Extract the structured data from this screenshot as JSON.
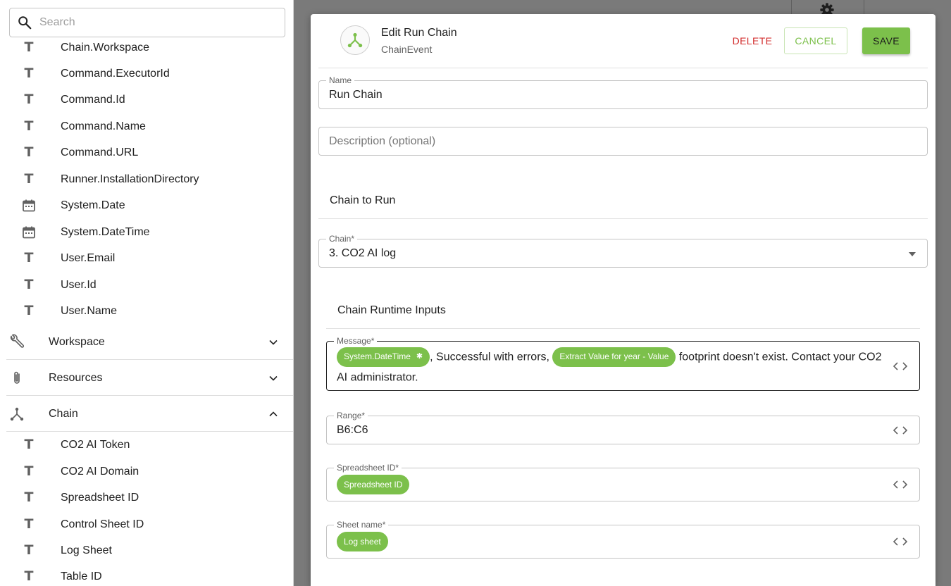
{
  "search": {
    "placeholder": "Search"
  },
  "variables_top": [
    {
      "label": "Chain.Workspace",
      "icon": "text-type-icon"
    },
    {
      "label": "Command.ExecutorId",
      "icon": "text-type-icon"
    },
    {
      "label": "Command.Id",
      "icon": "text-type-icon"
    },
    {
      "label": "Command.Name",
      "icon": "text-type-icon"
    },
    {
      "label": "Command.URL",
      "icon": "text-type-icon"
    },
    {
      "label": "Runner.InstallationDirectory",
      "icon": "text-type-icon"
    },
    {
      "label": "System.Date",
      "icon": "calendar-icon"
    },
    {
      "label": "System.DateTime",
      "icon": "calendar-icon"
    },
    {
      "label": "User.Email",
      "icon": "text-type-icon"
    },
    {
      "label": "User.Id",
      "icon": "text-type-icon"
    },
    {
      "label": "User.Name",
      "icon": "text-type-icon"
    }
  ],
  "sections": [
    {
      "label": "Workspace",
      "icon": "wrench-icon",
      "expanded": false
    },
    {
      "label": "Resources",
      "icon": "paperclip-icon",
      "expanded": false
    },
    {
      "label": "Chain",
      "icon": "chain-icon",
      "expanded": true
    }
  ],
  "chain_variables": [
    {
      "label": "CO2 AI Token"
    },
    {
      "label": "CO2 AI Domain"
    },
    {
      "label": "Spreadsheet ID"
    },
    {
      "label": "Control Sheet ID"
    },
    {
      "label": "Log Sheet"
    },
    {
      "label": "Table ID"
    }
  ],
  "modal": {
    "title": "Edit Run Chain",
    "subtitle": "ChainEvent",
    "delete_label": "DELETE",
    "cancel_label": "CANCEL",
    "save_label": "SAVE"
  },
  "form": {
    "name_label": "Name",
    "name_value": "Run Chain",
    "description_placeholder": "Description (optional)",
    "chain_to_run_title": "Chain to Run",
    "chain_label": "Chain*",
    "chain_value": "3. CO2 AI log",
    "runtime_inputs_title": "Chain Runtime Inputs",
    "message": {
      "label": "Message*",
      "chip1": "System.DateTime",
      "chip1_close": "✱",
      "text1": ", Successful with errors, ",
      "chip2": "Extract Value for year - Value",
      "text2": " footprint doesn't exist. Contact your CO2 AI administrator."
    },
    "range": {
      "label": "Range*",
      "value": "B6:C6"
    },
    "spreadsheet_id": {
      "label": "Spreadsheet ID*",
      "chip": "Spreadsheet ID"
    },
    "sheet_name": {
      "label": "Sheet name*",
      "chip": "Log sheet"
    }
  },
  "colors": {
    "accent": "#7cc04b",
    "danger": "#d32f2f"
  }
}
